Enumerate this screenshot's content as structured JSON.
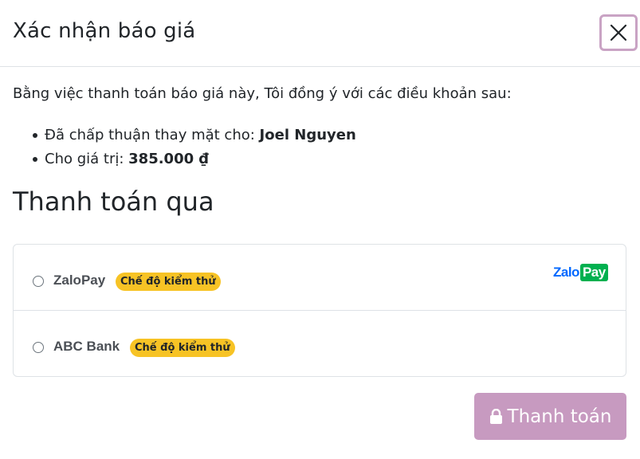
{
  "modal": {
    "title": "Xác nhận báo giá"
  },
  "agreement": {
    "intro": "Bằng việc thanh toán báo giá này, Tôi đồng ý với các điều khoản sau:",
    "terms": [
      {
        "prefix": "Đã chấp thuận thay mặt cho: ",
        "value": "Joel Nguyen"
      },
      {
        "prefix": "Cho giá trị: ",
        "value": "385.000 ₫"
      }
    ]
  },
  "payment": {
    "heading": "Thanh toán qua",
    "methods": [
      {
        "name": "ZaloPay",
        "badge": "Chế độ kiểm thử",
        "logo": {
          "part1": "Zalo",
          "part2": "Pay"
        }
      },
      {
        "name": "ABC Bank",
        "badge": "Chế độ kiểm thử"
      }
    ],
    "submit_label": "Thanh toán"
  },
  "icons": {
    "close": "close-icon",
    "lock": "lock-icon"
  },
  "colors": {
    "accent": "#c79ac0",
    "badge": "#f7c325",
    "zalo_blue": "#0068ff",
    "zalo_green": "#00b04f"
  }
}
